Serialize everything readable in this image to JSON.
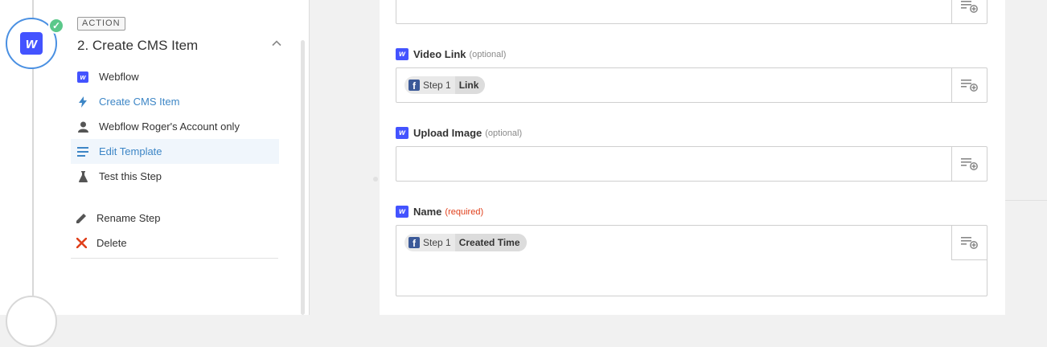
{
  "step": {
    "tag": "ACTION",
    "title": "2. Create CMS Item",
    "app_logo_letter": "w"
  },
  "menu": {
    "items": [
      {
        "label": "Webflow",
        "icon": "webflow-icon"
      },
      {
        "label": "Create CMS Item",
        "icon": "bolt-icon"
      },
      {
        "label": "Webflow Roger's Account only",
        "icon": "user-icon"
      },
      {
        "label": "Edit Template",
        "icon": "list-icon"
      },
      {
        "label": "Test this Step",
        "icon": "flask-icon"
      }
    ],
    "actions": [
      {
        "label": "Rename Step",
        "icon": "pencil-icon"
      },
      {
        "label": "Delete",
        "icon": "delete-x-icon"
      }
    ]
  },
  "fields": {
    "video_link": {
      "label": "Video Link",
      "note": "(optional)",
      "pill_step": "Step 1",
      "pill_value": "Link"
    },
    "upload_image": {
      "label": "Upload Image",
      "note": "(optional)"
    },
    "name": {
      "label": "Name",
      "note": "(required)",
      "pill_step": "Step 1",
      "pill_value": "Created Time"
    }
  },
  "colors": {
    "accent": "#4a90e2",
    "webflow": "#4353ff",
    "facebook": "#3b5998",
    "success": "#5bc88a",
    "required": "#e0401c",
    "delete": "#e0401c"
  }
}
